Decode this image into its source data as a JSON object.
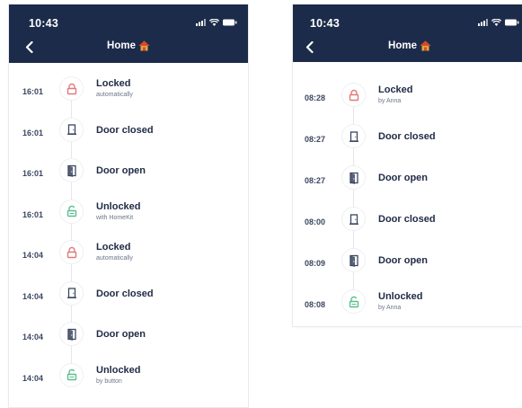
{
  "colors": {
    "header": "#1c2b4a",
    "locked": "#e07a7a",
    "unlocked": "#5bbf8e",
    "door": "#3b4660"
  },
  "left": {
    "time": "10:43",
    "title": "Home",
    "events": [
      {
        "time": "16:01",
        "icon": "lock-closed",
        "main": "Locked",
        "sub": "automatically"
      },
      {
        "time": "16:01",
        "icon": "door-closed",
        "main": "Door closed",
        "sub": ""
      },
      {
        "time": "16:01",
        "icon": "door-open",
        "main": "Door open",
        "sub": ""
      },
      {
        "time": "16:01",
        "icon": "lock-open",
        "main": "Unlocked",
        "sub": "with HomeKit"
      },
      {
        "time": "14:04",
        "icon": "lock-closed",
        "main": "Locked",
        "sub": "automatically"
      },
      {
        "time": "14:04",
        "icon": "door-closed",
        "main": "Door closed",
        "sub": ""
      },
      {
        "time": "14:04",
        "icon": "door-open",
        "main": "Door open",
        "sub": ""
      },
      {
        "time": "14:04",
        "icon": "lock-open",
        "main": "Unlocked",
        "sub": "by button"
      }
    ]
  },
  "right": {
    "time": "10:43",
    "title": "Home",
    "events": [
      {
        "time": "08:28",
        "icon": "lock-closed",
        "main": "Locked",
        "sub": "by Anna"
      },
      {
        "time": "08:27",
        "icon": "door-closed",
        "main": "Door closed",
        "sub": ""
      },
      {
        "time": "08:27",
        "icon": "door-open",
        "main": "Door open",
        "sub": ""
      },
      {
        "time": "08:00",
        "icon": "door-closed",
        "main": "Door closed",
        "sub": ""
      },
      {
        "time": "08:09",
        "icon": "door-open",
        "main": "Door open",
        "sub": ""
      },
      {
        "time": "08:08",
        "icon": "lock-open",
        "main": "Unlocked",
        "sub": "by Anna"
      }
    ]
  }
}
